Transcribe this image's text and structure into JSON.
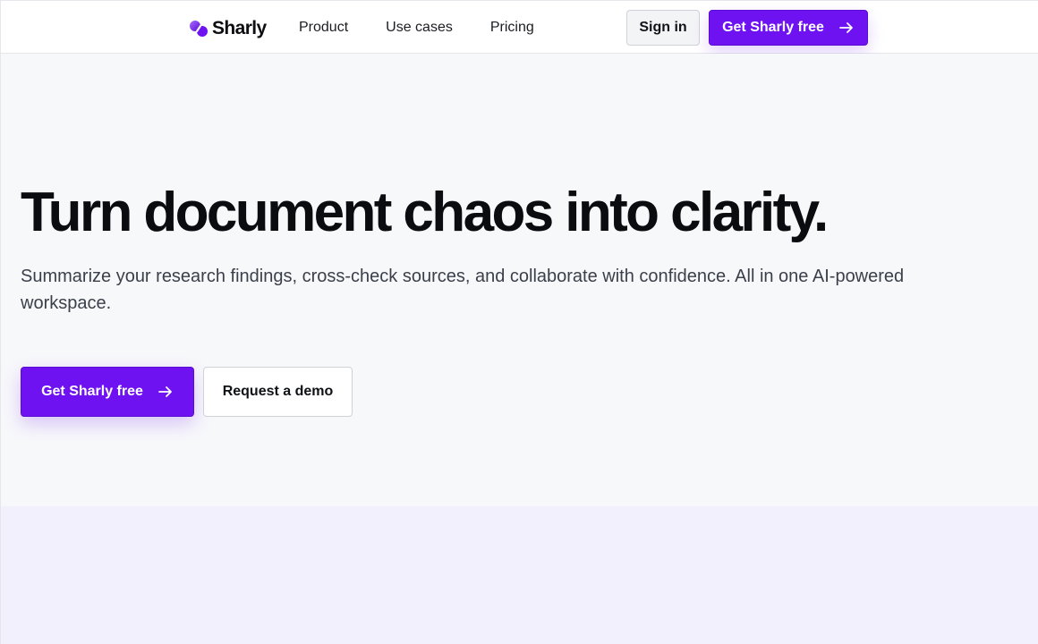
{
  "header": {
    "logo_text": "Sharly",
    "nav": [
      "Product",
      "Use cases",
      "Pricing"
    ],
    "signin_label": "Sign in",
    "cta_label": "Get Sharly free"
  },
  "hero": {
    "title": "Turn document chaos into clarity.",
    "subtitle": "Summarize your research findings, cross-check sources, and collaborate with confidence. All in one AI-powered workspace.",
    "primary_cta": "Get Sharly free",
    "secondary_cta": "Request a demo"
  },
  "colors": {
    "brand": "#6f12f2",
    "hero_bg": "#f7f8fa",
    "band_bg": "#f2f0fd"
  },
  "icons": {
    "logo": "sharly-logo-icon",
    "arrow": "arrow-right-icon"
  }
}
